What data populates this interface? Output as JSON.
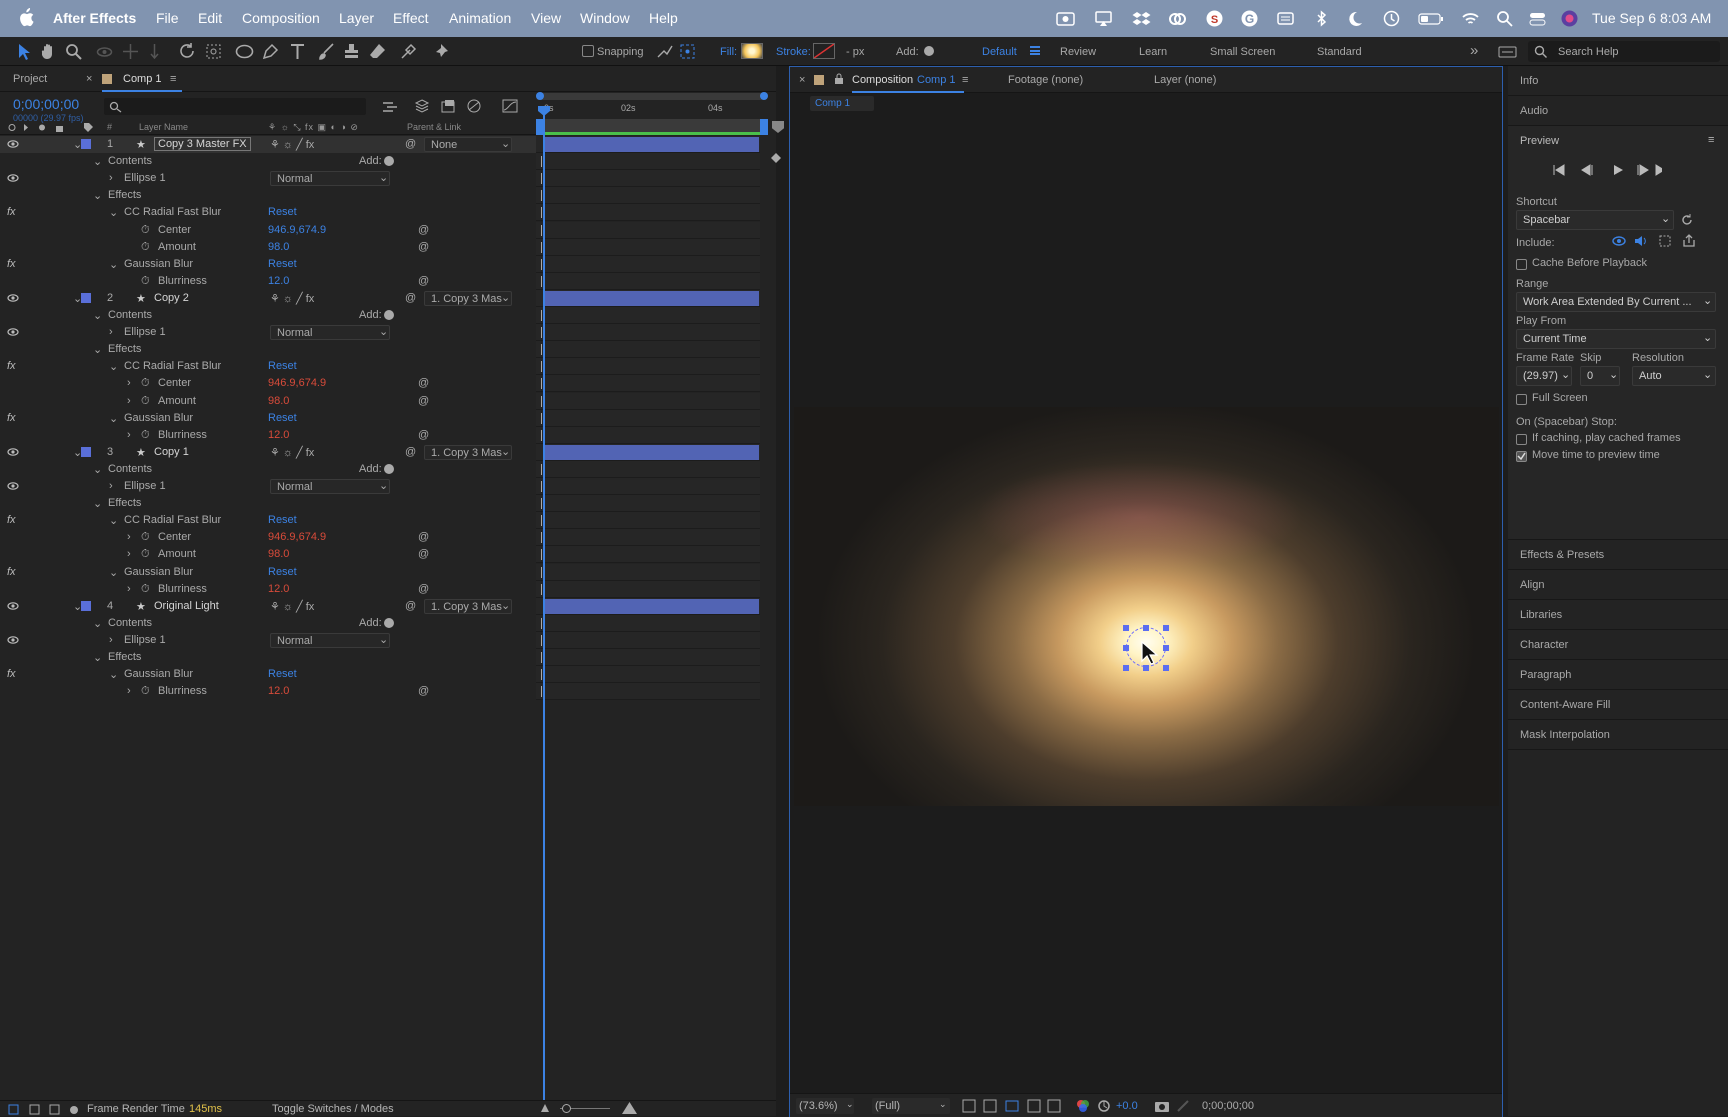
{
  "menubar": {
    "app": "After Effects",
    "items": [
      "File",
      "Edit",
      "Composition",
      "Layer",
      "Effect",
      "Animation",
      "View",
      "Window",
      "Help"
    ],
    "clock": "Tue Sep 6  8:03 AM"
  },
  "toolbar": {
    "snapping": "Snapping",
    "fill": "Fill:",
    "stroke": "Stroke:",
    "stroke_units": "- px",
    "add": "Add:",
    "workspaces": [
      "Default",
      "Review",
      "Learn",
      "Small Screen",
      "Standard"
    ],
    "search_placeholder": "Search Help"
  },
  "timeline": {
    "tab_project": "Project",
    "tab_comp": "Comp 1",
    "timecode": "0;00;00;00",
    "timecode_sub": "00000 (29.97 fps)",
    "ruler": [
      "0s",
      "02s",
      "04s"
    ],
    "col_layer_name": "Layer Name",
    "col_parent": "Parent & Link",
    "layers": [
      {
        "num": "1",
        "name": "Copy 3 Master FX",
        "parent": "None",
        "blend": "Normal",
        "blur_center": "946.9,674.9",
        "blur_amount": "98.0",
        "blurriness": "12.0"
      },
      {
        "num": "2",
        "name": "Copy 2",
        "parent": "1. Copy 3 Mas",
        "blend": "Normal",
        "blur_center": "946.9,674.9",
        "blur_amount": "98.0",
        "blurriness": "12.0"
      },
      {
        "num": "3",
        "name": "Copy 1",
        "parent": "1. Copy 3 Mas",
        "blend": "Normal",
        "blur_center": "946.9,674.9",
        "blur_amount": "98.0",
        "blurriness": "12.0"
      },
      {
        "num": "4",
        "name": "Original Light",
        "parent": "1. Copy 3 Mas",
        "blend": "Normal",
        "blurriness": "12.0"
      }
    ],
    "labels": {
      "contents": "Contents",
      "add": "Add:",
      "ellipse": "Ellipse 1",
      "effects": "Effects",
      "radial_blur": "CC Radial Fast Blur",
      "gaussian": "Gaussian Blur",
      "reset": "Reset",
      "center": "Center",
      "amount": "Amount",
      "blurriness": "Blurriness"
    },
    "footer": {
      "render_label": "Frame Render Time",
      "render_value": "145ms",
      "toggle": "Toggle Switches / Modes"
    }
  },
  "composition": {
    "tab_prefix": "Composition",
    "tab_name": "Comp 1",
    "footage": "Footage (none)",
    "layer": "Layer (none)",
    "sub_tab": "Comp 1",
    "zoom": "(73.6%)",
    "resolution": "(Full)",
    "exposure": "+0.0",
    "timecode": "0;00;00;00"
  },
  "panels": {
    "info": "Info",
    "audio": "Audio",
    "preview": "Preview",
    "shortcut_label": "Shortcut",
    "shortcut": "Spacebar",
    "include": "Include:",
    "cache": "Cache Before Playback",
    "range_label": "Range",
    "range": "Work Area Extended By Current ...",
    "play_from_label": "Play From",
    "play_from": "Current Time",
    "frame_rate_label": "Frame Rate",
    "skip_label": "Skip",
    "resolution_label": "Resolution",
    "frame_rate": "(29.97)",
    "skip": "0",
    "resolution": "Auto",
    "full_screen": "Full Screen",
    "on_stop": "On (Spacebar) Stop:",
    "if_caching": "If caching, play cached frames",
    "move_time": "Move time to preview time",
    "collapsed": [
      "Effects & Presets",
      "Align",
      "Libraries",
      "Character",
      "Paragraph",
      "Content-Aware Fill",
      "Mask Interpolation"
    ]
  },
  "colors": {
    "accent": "#3c82e3",
    "layer_bar": "#5264b4",
    "menubar": "#8194b0",
    "keyframe_red": "#d84b3a"
  }
}
